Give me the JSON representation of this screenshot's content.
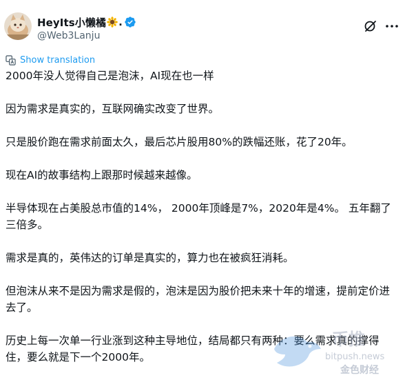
{
  "author": {
    "display_name": "HeyIts小懒橘",
    "name_suffix": ".",
    "handle": "@Web3Lanju",
    "emoji_icon": "sunflower-icon",
    "verified_icon": "verified-badge-icon",
    "verified_color": "#1d9bf0"
  },
  "header_actions": {
    "grok_icon": "grok-icon",
    "more_icon": "more-icon"
  },
  "translation": {
    "label": "Show translation",
    "icon": "translate-icon",
    "color": "#1d9bf0"
  },
  "post": {
    "paragraphs": [
      "2000年没人觉得自己是泡沫，AI现在也一样",
      "因为需求是真实的，互联网确实改变了世界。",
      "只是股价跑在需求前面太久，最后芯片股用80%的跌幅还账，花了20年。",
      "现在AI的故事结构上跟那时候越来越像。",
      "半导体现在占美股总市值的14%， 2000年顶峰是7%，2020年是4%。 五年翻了三倍多。",
      "需求是真的，英伟达的订单是真实的，算力也在被疯狂消耗。",
      "但泡沫从来不是因为需求是假的，泡沫是因为股价把未来十年的增速，提前定价进去了。",
      "历史上每一次单一行业涨到这种主导地位，结局都只有两种：要么需求真的撑得住，要么就是下一个2000年。"
    ]
  },
  "watermark": {
    "brand": "币推",
    "url": "bitpush.news",
    "sub": "金色财经"
  },
  "colors": {
    "text": "#0f1419",
    "secondary": "#536471",
    "accent": "#1d9bf0",
    "background": "#ffffff"
  }
}
